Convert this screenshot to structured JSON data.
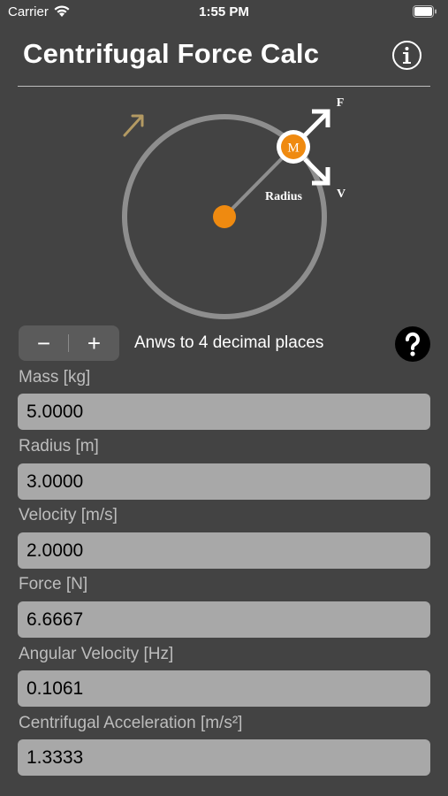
{
  "status_bar": {
    "carrier": "Carrier",
    "time": "1:55 PM"
  },
  "header": {
    "title": "Centrifugal Force Calc",
    "info_icon": "info-icon"
  },
  "diagram": {
    "mass_label": "M",
    "radius_label": "Radius",
    "force_label": "F",
    "velocity_label": "V",
    "colors": {
      "orbit": "#8e8e8e",
      "mass": "#ef8a10",
      "rotation_arrow": "#b39a63",
      "arrows": "#ffffff"
    }
  },
  "precision": {
    "minus_label": "−",
    "plus_label": "+",
    "label": "Anws to 4 decimal places",
    "help_icon": "question-icon"
  },
  "fields": [
    {
      "label": "Mass [kg]",
      "value": "5.0000"
    },
    {
      "label": "Radius [m]",
      "value": "3.0000"
    },
    {
      "label": "Velocity [m/s]",
      "value": "2.0000"
    },
    {
      "label": "Force [N]",
      "value": "6.6667"
    },
    {
      "label": "Angular Velocity [Hz]",
      "value": "0.1061"
    },
    {
      "label": "Centrifugal Acceleration [m/s²]",
      "value": "1.3333"
    }
  ]
}
